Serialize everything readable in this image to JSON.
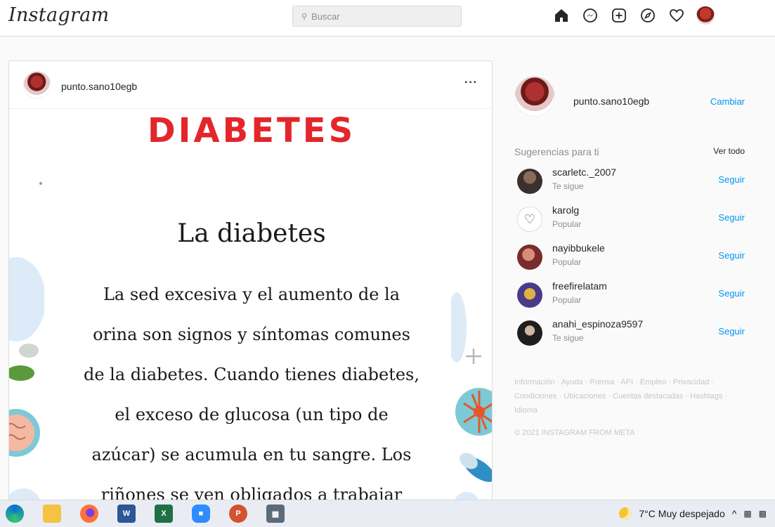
{
  "nav": {
    "logo": "Instagram",
    "search_placeholder": "Buscar",
    "icons": [
      "home-icon",
      "messenger-icon",
      "new-post-icon",
      "explore-icon",
      "activity-heart-icon",
      "profile-avatar"
    ]
  },
  "post": {
    "username": "punto.sano10egb",
    "more": "···",
    "media": {
      "title": "DIABETES",
      "subtitle": "La diabetes",
      "lines": [
        "La sed excesiva y el aumento de la",
        "orina son signos y síntomas comunes",
        "de la diabetes. Cuando tienes diabetes,",
        "el exceso de glucosa (un tipo de",
        "azúcar) se acumula en tu sangre. Los",
        "riñones se ven obligados a trabajar"
      ]
    }
  },
  "sidebar": {
    "me": {
      "username": "punto.sano10egb",
      "switch": "Cambiar"
    },
    "suggestions_title": "Sugerencias para ti",
    "see_all": "Ver todo",
    "suggestions": [
      {
        "name": "scarletc._2007",
        "note": "Te sigue",
        "action": "Seguir"
      },
      {
        "name": "karolg",
        "note": "Popular",
        "action": "Seguir"
      },
      {
        "name": "nayibbukele",
        "note": "Popular",
        "action": "Seguir"
      },
      {
        "name": "freefirelatam",
        "note": "Popular",
        "action": "Seguir"
      },
      {
        "name": "anahi_espinoza9597",
        "note": "Te sigue",
        "action": "Seguir"
      }
    ],
    "footer_links": "Información · Ayuda · Prensa · API · Empleo · Privacidad · Condiciones · Ubicaciones · Cuentas destacadas · Hashtags · Idioma",
    "copyright": "© 2021 INSTAGRAM FROM META"
  },
  "taskbar": {
    "apps": [
      "edge-icon",
      "file-explorer-icon",
      "firefox-icon",
      "word-icon",
      "excel-icon",
      "zoom-icon",
      "powerpoint-icon",
      "calculator-icon"
    ],
    "weather": "7°C  Muy despejado",
    "chevron": "^"
  },
  "colors": {
    "brand_blue": "#0095f6",
    "title_red": "#e3262b"
  }
}
